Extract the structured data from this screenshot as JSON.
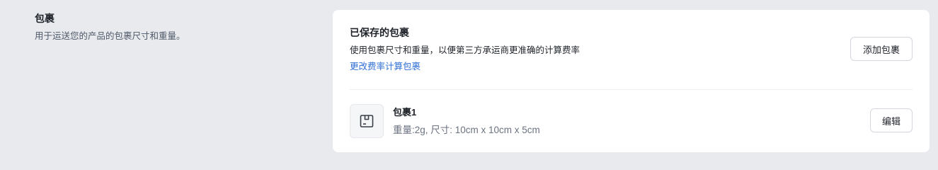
{
  "section": {
    "title": "包裹",
    "description": "用于运送您的产品的包裹尺寸和重量。"
  },
  "card": {
    "title": "已保存的包裹",
    "description": "使用包裹尺寸和重量，以便第三方承运商更准确的计算费率",
    "link_label": "更改费率计算包裹",
    "add_button_label": "添加包裹"
  },
  "packages": [
    {
      "name": "包裹1",
      "detail": "重量:2g, 尺寸: 10cm x 10cm x 5cm",
      "icon": "package-box-icon",
      "edit_label": "编辑"
    }
  ],
  "colors": {
    "background": "#e8eaee",
    "card": "#ffffff",
    "link": "#2f6fd6",
    "muted_text": "#6b7280"
  }
}
